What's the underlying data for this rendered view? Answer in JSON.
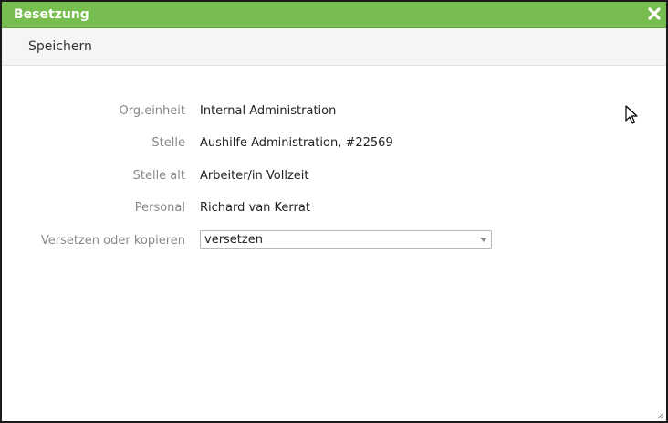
{
  "dialog": {
    "title": "Besetzung",
    "close_icon": "close-icon"
  },
  "toolbar": {
    "save_label": "Speichern"
  },
  "form": {
    "org_einheit": {
      "label": "Org.einheit",
      "value": "Internal Administration"
    },
    "stelle": {
      "label": "Stelle",
      "value": "Aushilfe Administration, #22569"
    },
    "stelle_alt": {
      "label": "Stelle alt",
      "value": "Arbeiter/in Vollzeit"
    },
    "personal": {
      "label": "Personal",
      "value": "Richard van Kerrat"
    },
    "versetzen": {
      "label": "Versetzen oder kopieren",
      "value": "versetzen"
    }
  },
  "colors": {
    "titlebar": "#78bd4f",
    "toolbar": "#f5f5f5",
    "label_text": "#888888",
    "value_text": "#222222"
  }
}
